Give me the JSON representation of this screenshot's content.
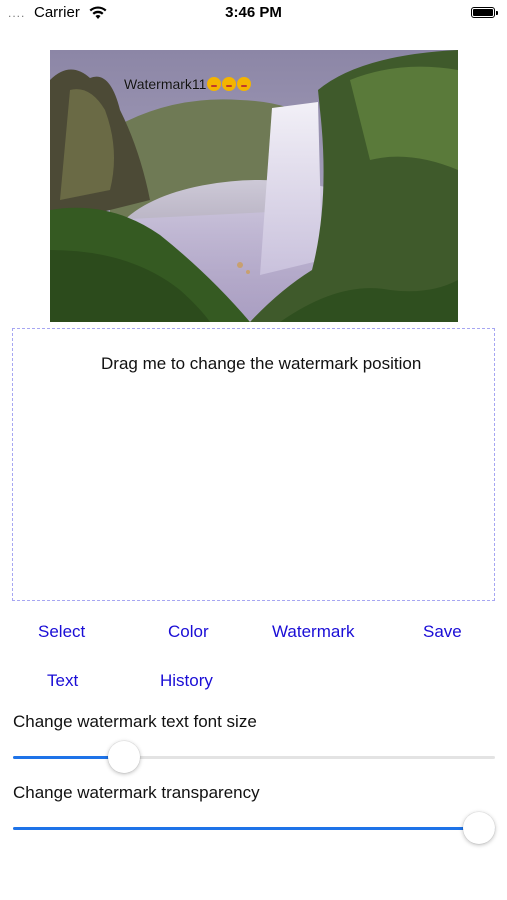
{
  "status_bar": {
    "signal": "....",
    "carrier": "Carrier",
    "time": "3:46 PM"
  },
  "preview": {
    "watermark_text": "Watermark11",
    "emoji_count": 3
  },
  "drag_area": {
    "label": "Drag me to change the watermark position"
  },
  "toolbar": {
    "select": "Select",
    "color": "Color",
    "watermark": "Watermark",
    "save": "Save",
    "text": "Text",
    "history": "History"
  },
  "font_size_slider": {
    "label": "Change watermark text font size",
    "value_fraction": 0.23
  },
  "transparency_slider": {
    "label": "Change watermark transparency",
    "value_fraction": 1.0
  },
  "colors": {
    "accent": "#1e73e8",
    "button_text": "#1a0dd6",
    "dashed_border": "#a6a6f2"
  }
}
